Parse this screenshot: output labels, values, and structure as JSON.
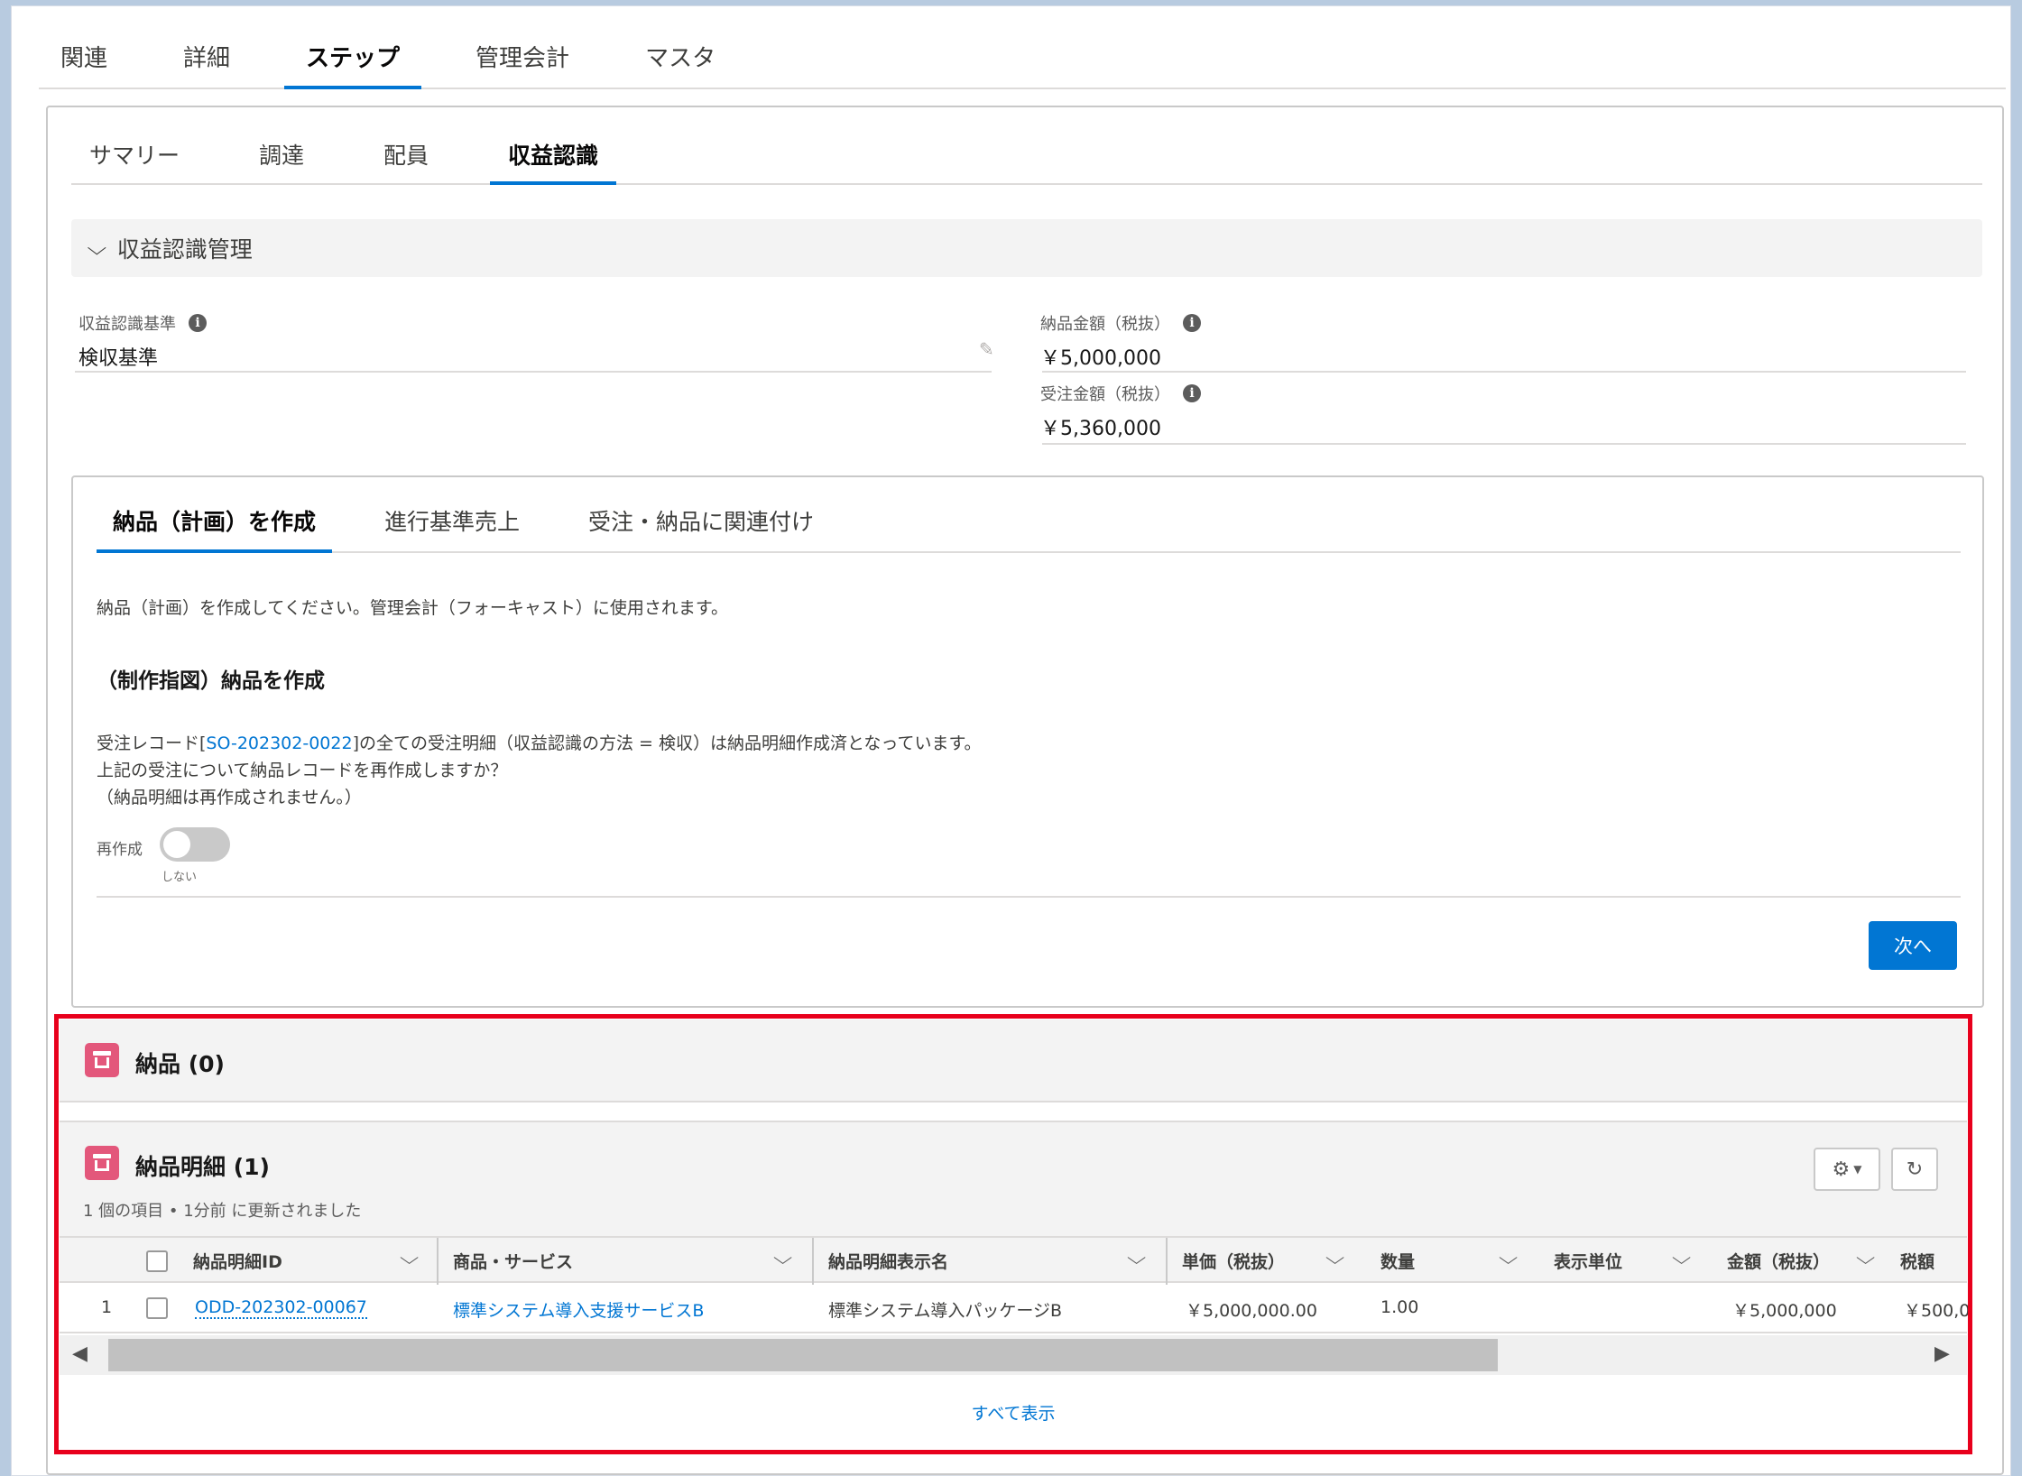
{
  "top_tabs": [
    "関連",
    "詳細",
    "ステップ",
    "管理会計",
    "マスタ"
  ],
  "sub_tabs": [
    "サマリー",
    "調達",
    "配員",
    "収益認識"
  ],
  "section": {
    "title": "収益認識管理"
  },
  "fields": {
    "basis_label": "収益認識基準",
    "basis_value": "検収基準",
    "delivery_amount_label": "納品金額（税抜）",
    "delivery_amount_value": "￥5,000,000",
    "order_amount_label": "受注金額（税抜）",
    "order_amount_value": "￥5,360,000"
  },
  "wizard": {
    "tabs": [
      "納品（計画）を作成",
      "進行基準売上",
      "受注・納品に関連付け"
    ],
    "intro": "納品（計画）を作成してください。管理会計（フォーキャスト）に使用されます。",
    "title": "（制作指図）納品を作成",
    "line1_prefix": "受注レコード[",
    "line1_link": "SO-202302-0022",
    "line1_suffix": "]の全ての受注明細（収益認識の方法 = 検収）は納品明細作成済となっています。",
    "line2": "上記の受注について納品レコードを再作成しますか？",
    "line3": "（納品明細は再作成されません。）",
    "toggle_label": "再作成",
    "toggle_state": "しない",
    "next_button": "次へ"
  },
  "related_deliveries": {
    "title": "納品 (0)"
  },
  "related_lines": {
    "title": "納品明細 (1)",
    "subtitle": "1 個の項目 • 1分前 に更新されました",
    "columns": [
      "納品明細ID",
      "商品・サービス",
      "納品明細表示名",
      "単価（税抜）",
      "数量",
      "表示単位",
      "金額（税抜）",
      "税額"
    ],
    "rows": [
      {
        "num": "1",
        "id": "ODD-202302-00067",
        "product": "標準システム導入支援サービスB",
        "display_name": "標準システム導入パッケージB",
        "unit_price": "￥5,000,000.00",
        "qty": "1.00",
        "unit": "",
        "amount": "￥5,000,000",
        "tax": "￥500,0"
      }
    ],
    "view_all": "すべて表示"
  },
  "colors": {
    "accent": "#0176d3",
    "highlight_frame": "#e8001c",
    "object_icon": "#e3577b"
  }
}
